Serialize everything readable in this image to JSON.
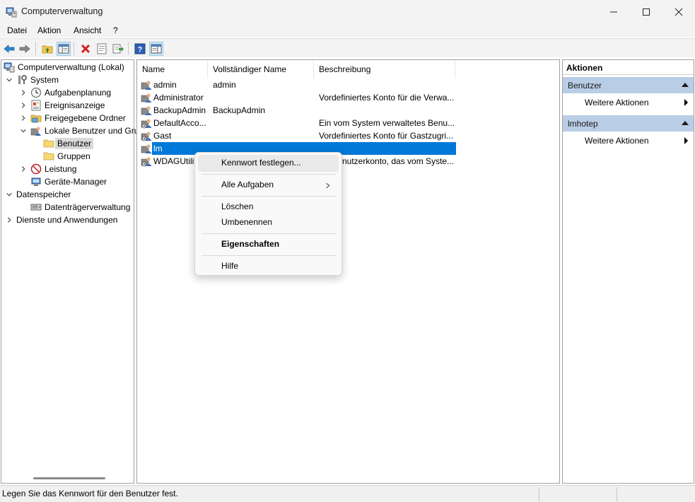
{
  "window": {
    "title": "Computerverwaltung",
    "controls": [
      "minimize",
      "maximize",
      "close"
    ]
  },
  "menu": [
    "Datei",
    "Aktion",
    "Ansicht",
    "?"
  ],
  "toolbar": {
    "icons": [
      "back-arrow-icon",
      "forward-arrow-icon",
      "up-folder-icon",
      "show-hide-tree-icon",
      "delete-icon",
      "properties-icon",
      "export-list-icon",
      "help-icon",
      "show-hide-action-pane-icon"
    ]
  },
  "tree": [
    {
      "label": "Computerverwaltung (Lokal)",
      "icon": "computer-management-icon"
    },
    {
      "label": "System",
      "icon": "system-tools-icon"
    },
    {
      "label": "Aufgabenplanung",
      "icon": "clock-icon"
    },
    {
      "label": "Ereignisanzeige",
      "icon": "event-viewer-icon"
    },
    {
      "label": "Freigegebene Ordner",
      "icon": "shared-folder-icon"
    },
    {
      "label": "Lokale Benutzer und Gru",
      "icon": "users-group-icon"
    },
    {
      "label": "Benutzer",
      "icon": "folder-icon"
    },
    {
      "label": "Gruppen",
      "icon": "folder-icon"
    },
    {
      "label": "Leistung",
      "icon": "performance-icon"
    },
    {
      "label": "Geräte-Manager",
      "icon": "device-manager-icon"
    },
    {
      "label": "Datenspeicher",
      "icon": "storage-icon"
    },
    {
      "label": "Datenträgerverwaltung",
      "icon": "disk-management-icon"
    },
    {
      "label": "Dienste und Anwendungen",
      "icon": "services-icon"
    }
  ],
  "list": {
    "columns": [
      "Name",
      "Vollständiger Name",
      "Beschreibung"
    ],
    "rows": [
      {
        "name": "admin",
        "fullname": "admin",
        "description": ""
      },
      {
        "name": "Administrator",
        "fullname": "",
        "description": "Vordefiniertes Konto für die Verwa..."
      },
      {
        "name": "BackupAdmin",
        "fullname": "BackupAdmin",
        "description": ""
      },
      {
        "name": "DefaultAcco...",
        "fullname": "",
        "description": "Ein vom System verwaltetes Benu..."
      },
      {
        "name": "Gast",
        "fullname": "",
        "description": "Vordefiniertes Konto für Gastzugri..."
      },
      {
        "name": "lm",
        "fullname": "",
        "description": ""
      },
      {
        "name": "WDAGUtilit",
        "fullname": "",
        "description": "nutzerkonto, das vom Syste..."
      }
    ],
    "selected_row": "lm"
  },
  "context_menu": {
    "items": [
      {
        "label": "Kennwort festlegen...",
        "hovered": true
      },
      {
        "label": "Alle Aufgaben",
        "submenu": ">"
      },
      {
        "label": "Löschen"
      },
      {
        "label": "Umbenennen"
      },
      {
        "label": "Eigenschaften",
        "bold": true
      },
      {
        "label": "Hilfe"
      }
    ]
  },
  "actions": {
    "title": "Aktionen",
    "sections": [
      {
        "header": "Benutzer",
        "item": "Weitere Aktionen"
      },
      {
        "header": "lmhotep",
        "item": "Weitere Aktionen"
      }
    ]
  },
  "status": {
    "message": "Legen Sie das Kennwort für den Benutzer fest."
  },
  "colors": {
    "selection": "#0078d7",
    "action_header": "#b9cde6",
    "tree_selected": "#d9d9d9"
  }
}
